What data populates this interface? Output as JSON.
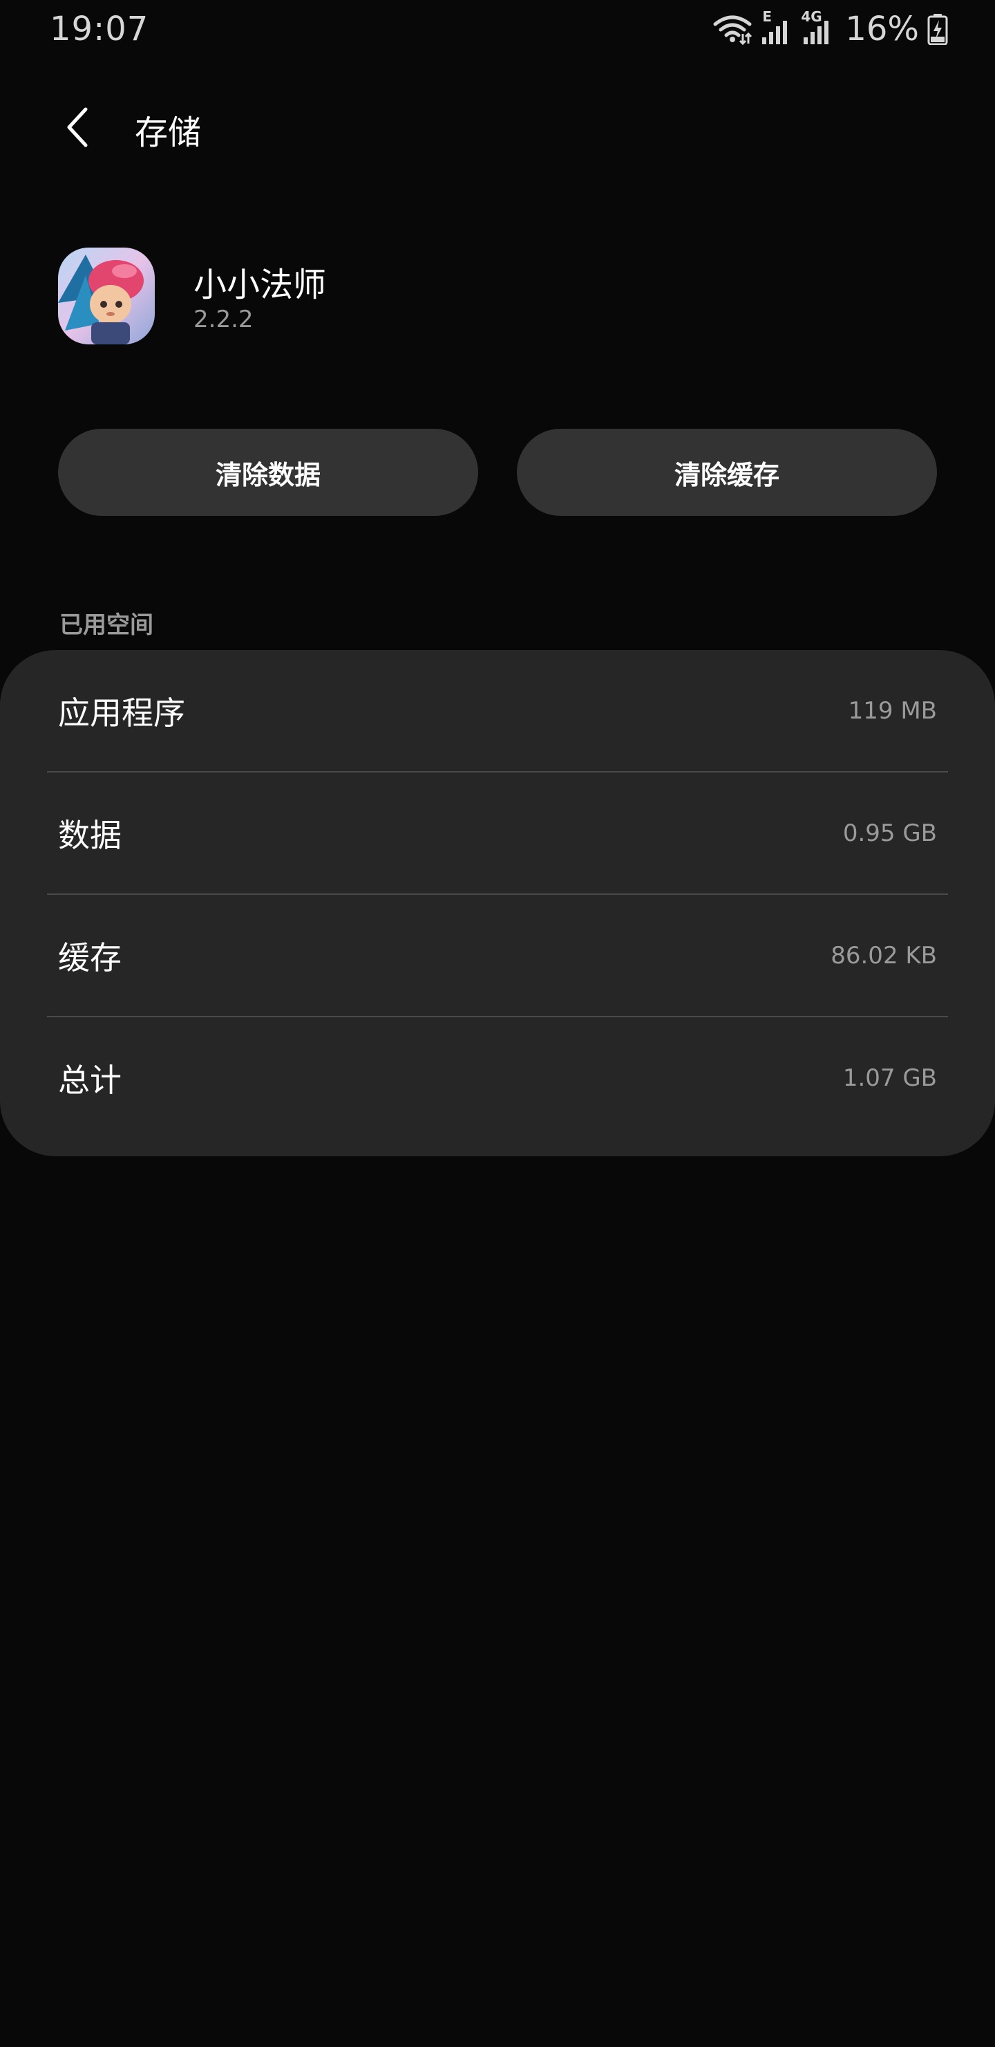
{
  "status_bar": {
    "time": "19:07",
    "network_e": "E",
    "network_4g": "4G",
    "battery": "16%",
    "icons": [
      "wifi-icon",
      "signal-e-icon",
      "signal-4g-icon",
      "battery-charging-icon"
    ]
  },
  "header": {
    "title": "存储",
    "back_icon": "chevron-left-icon"
  },
  "app": {
    "name": "小小法师",
    "version": "2.2.2"
  },
  "actions": {
    "clear_data": "清除数据",
    "clear_cache": "清除缓存"
  },
  "storage": {
    "section_title": "已用空间",
    "rows": [
      {
        "label": "应用程序",
        "value": "119 MB"
      },
      {
        "label": "数据",
        "value": "0.95 GB"
      },
      {
        "label": "缓存",
        "value": "86.02 KB"
      },
      {
        "label": "总计",
        "value": "1.07 GB"
      }
    ]
  },
  "colors": {
    "background": "#080808",
    "card": "#262626",
    "button": "#333333",
    "secondary_text": "#9a9a9a"
  }
}
